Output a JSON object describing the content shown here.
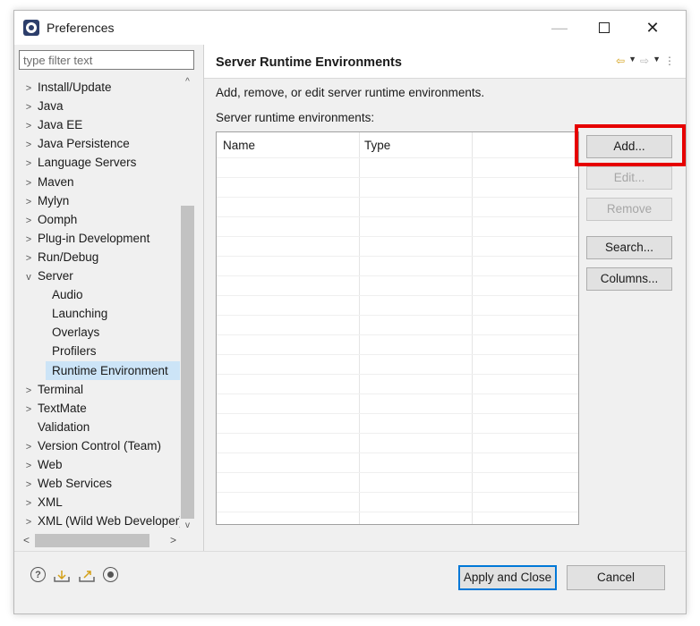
{
  "window": {
    "title": "Preferences",
    "min_glyph": "—",
    "close_glyph": "✕"
  },
  "filter": {
    "placeholder": "type filter text",
    "value": ""
  },
  "tree": {
    "items": [
      {
        "label": "Install/Update",
        "twisty": ">",
        "level": 0
      },
      {
        "label": "Java",
        "twisty": ">",
        "level": 0
      },
      {
        "label": "Java EE",
        "twisty": ">",
        "level": 0
      },
      {
        "label": "Java Persistence",
        "twisty": ">",
        "level": 0
      },
      {
        "label": "Language Servers",
        "twisty": ">",
        "level": 0
      },
      {
        "label": "Maven",
        "twisty": ">",
        "level": 0
      },
      {
        "label": "Mylyn",
        "twisty": ">",
        "level": 0
      },
      {
        "label": "Oomph",
        "twisty": ">",
        "level": 0
      },
      {
        "label": "Plug-in Development",
        "twisty": ">",
        "level": 0
      },
      {
        "label": "Run/Debug",
        "twisty": ">",
        "level": 0
      },
      {
        "label": "Server",
        "twisty": "v",
        "level": 0
      },
      {
        "label": "Audio",
        "twisty": "",
        "level": 1
      },
      {
        "label": "Launching",
        "twisty": "",
        "level": 1
      },
      {
        "label": "Overlays",
        "twisty": "",
        "level": 1
      },
      {
        "label": "Profilers",
        "twisty": "",
        "level": 1
      },
      {
        "label": "Runtime Environment",
        "twisty": "",
        "level": 1,
        "selected": true
      },
      {
        "label": "Terminal",
        "twisty": ">",
        "level": 0
      },
      {
        "label": "TextMate",
        "twisty": ">",
        "level": 0
      },
      {
        "label": "Validation",
        "twisty": "",
        "level": 0
      },
      {
        "label": "Version Control (Team)",
        "twisty": ">",
        "level": 0
      },
      {
        "label": "Web",
        "twisty": ">",
        "level": 0
      },
      {
        "label": "Web Services",
        "twisty": ">",
        "level": 0
      },
      {
        "label": "XML",
        "twisty": ">",
        "level": 0
      },
      {
        "label": "XML (Wild Web Developer)",
        "twisty": ">",
        "level": 0
      }
    ],
    "scroll_up": "^",
    "scroll_down": "v",
    "scroll_left": "<",
    "scroll_right": ">"
  },
  "page": {
    "title": "Server Runtime Environments",
    "description": "Add, remove, or edit server runtime environments.",
    "table_label": "Server runtime environments:",
    "columns": [
      "Name",
      "Type"
    ]
  },
  "nav": {
    "back": "⇦",
    "forward": "⇨",
    "dropdown": "▼",
    "menu": "⋮"
  },
  "buttons": {
    "add": "Add...",
    "edit": "Edit...",
    "remove": "Remove",
    "search": "Search...",
    "columns": "Columns..."
  },
  "footer": {
    "help": "?",
    "apply_close": "Apply and Close",
    "cancel": "Cancel"
  },
  "colors": {
    "highlight": "#e60000",
    "selection": "#cce4f7",
    "primary_border": "#0078d7"
  }
}
